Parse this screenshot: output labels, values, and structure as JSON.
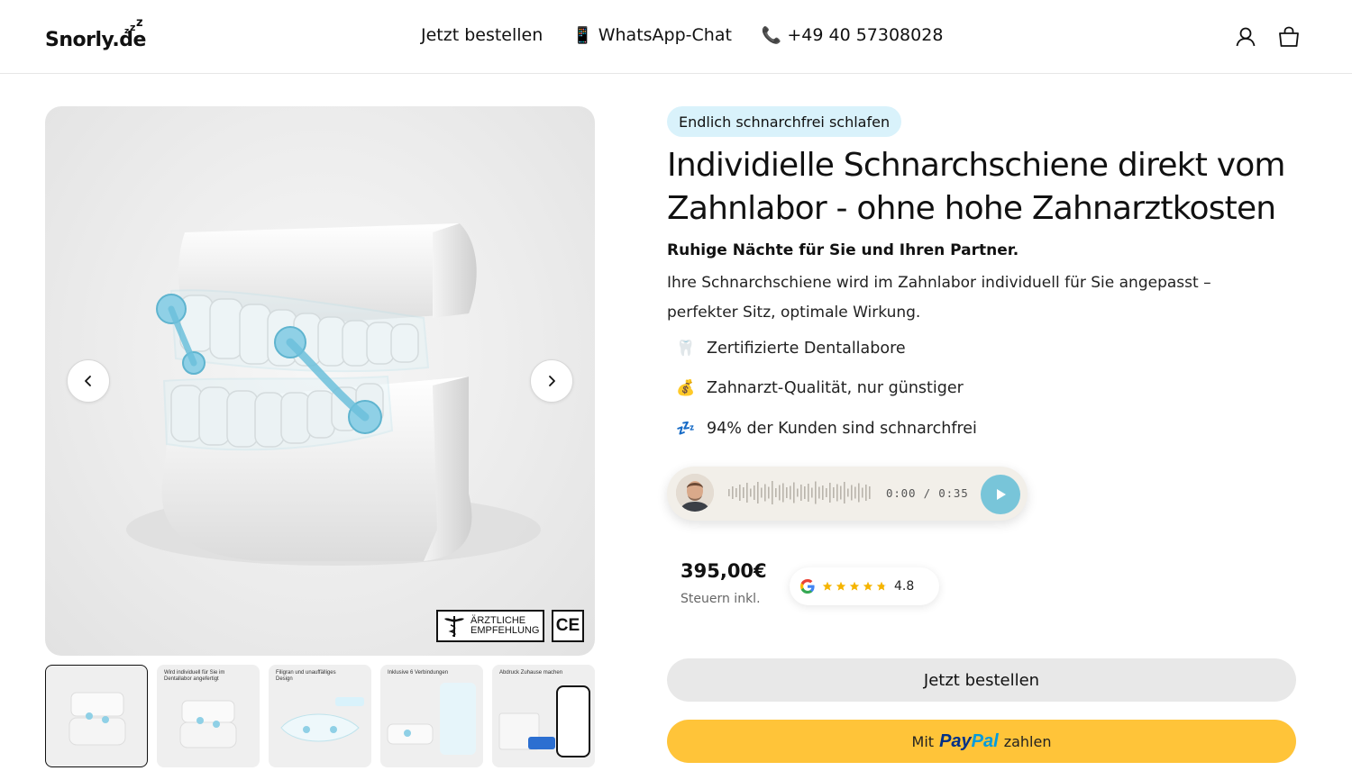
{
  "header": {
    "logo_text": "Snorly.de",
    "logo_z": "z",
    "nav": [
      {
        "icon": "mobile-phone-icon",
        "glyph": "",
        "label": "Jetzt bestellen"
      },
      {
        "icon": "mobile-phone-icon",
        "glyph": "📱",
        "label": "WhatsApp-Chat"
      },
      {
        "icon": "telephone-icon",
        "glyph": "📞",
        "label": "+49 40 57308028"
      }
    ]
  },
  "gallery": {
    "badge_text_1": "ÄRZTLICHE",
    "badge_text_2": "EMPFEHLUNG",
    "ce_mark": "CE",
    "thumbnails": [
      {
        "caption": ""
      },
      {
        "caption": "Wird individuell für Sie im Dentallabor angefertigt"
      },
      {
        "caption": "Filigran und unauffälliges Design"
      },
      {
        "caption": "Inklusive 6 Verbindungen"
      },
      {
        "caption": "Abdruck Zuhause machen"
      }
    ]
  },
  "product": {
    "pill": "Endlich schnarchfrei schlafen",
    "title": "Individielle Schnarchschiene direkt vom Zahnlabor - ohne hohe Zahnarztkosten",
    "subtitle": "Ruhige Nächte für Sie und Ihren Partner.",
    "description": "Ihre Schnarchschiene wird im Zahnlabor individuell für Sie angepasst – perfekter Sitz, optimale Wirkung.",
    "features": [
      {
        "icon": "tooth-icon",
        "glyph": "🦷",
        "label": "Zertifizierte Dentallabore"
      },
      {
        "icon": "money-bag-icon",
        "glyph": "💰",
        "label": "Zahnarzt-Qualität, nur günstiger"
      },
      {
        "icon": "sleeping-zzz-icon",
        "glyph": "💤",
        "label": "94% der Kunden sind schnarchfrei"
      }
    ],
    "audio": {
      "time": "0:00 / 0:35",
      "progress": 0
    },
    "price": "395,00€",
    "tax_note": "Steuern inkl.",
    "rating": {
      "value": "4.8",
      "stars": 4.8,
      "max": 5
    },
    "order_button": "Jetzt bestellen",
    "paypal": {
      "prefix": "Mit",
      "brand_1": "Pay",
      "brand_2": "Pal",
      "suffix": "zahlen"
    }
  },
  "colors": {
    "pill_bg": "#d9f2fb",
    "play_button": "#78c5d9",
    "paypal_button": "#ffc439",
    "order_button": "#e8e8e8",
    "star": "#f5b400"
  }
}
